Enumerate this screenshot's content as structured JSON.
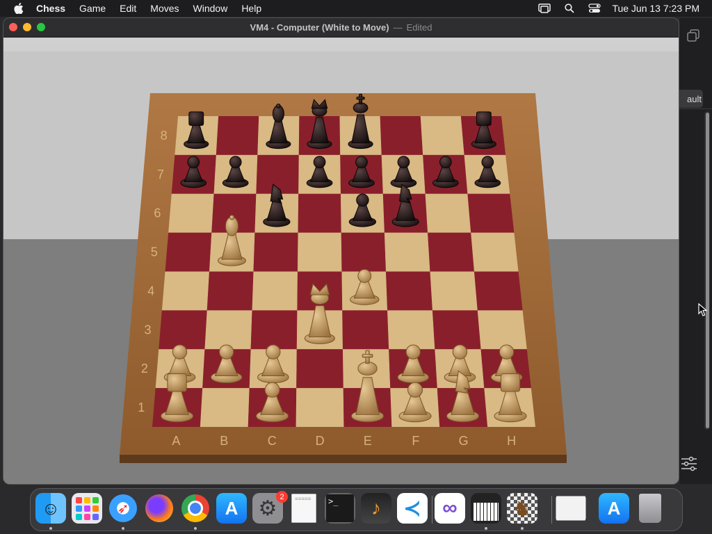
{
  "menubar": {
    "app_name": "Chess",
    "items": [
      "Game",
      "Edit",
      "Moves",
      "Window",
      "Help"
    ],
    "clock": "Tue Jun 13  7:23 PM"
  },
  "window": {
    "title": "VM4 - Computer   (White to Move)",
    "separator": "—",
    "edited": "Edited"
  },
  "background_window": {
    "button_label": "ault"
  },
  "board": {
    "files": [
      "A",
      "B",
      "C",
      "D",
      "E",
      "F",
      "G",
      "H"
    ],
    "ranks": [
      "8",
      "7",
      "6",
      "5",
      "4",
      "3",
      "2",
      "1"
    ],
    "pieces": [
      {
        "color": "black",
        "type": "rook",
        "square": "a8"
      },
      {
        "color": "black",
        "type": "bishop",
        "square": "c8"
      },
      {
        "color": "black",
        "type": "queen",
        "square": "d8"
      },
      {
        "color": "black",
        "type": "king",
        "square": "e8"
      },
      {
        "color": "black",
        "type": "rook",
        "square": "h8"
      },
      {
        "color": "black",
        "type": "pawn",
        "square": "a7"
      },
      {
        "color": "black",
        "type": "pawn",
        "square": "b7"
      },
      {
        "color": "black",
        "type": "pawn",
        "square": "d7"
      },
      {
        "color": "black",
        "type": "pawn",
        "square": "e7"
      },
      {
        "color": "black",
        "type": "pawn",
        "square": "f7"
      },
      {
        "color": "black",
        "type": "pawn",
        "square": "g7"
      },
      {
        "color": "black",
        "type": "pawn",
        "square": "h7"
      },
      {
        "color": "black",
        "type": "knight",
        "square": "c6"
      },
      {
        "color": "black",
        "type": "pawn",
        "square": "e6"
      },
      {
        "color": "black",
        "type": "knight",
        "square": "f6"
      },
      {
        "color": "white",
        "type": "bishop",
        "square": "b5"
      },
      {
        "color": "white",
        "type": "pawn",
        "square": "e4"
      },
      {
        "color": "white",
        "type": "queen",
        "square": "d3"
      },
      {
        "color": "white",
        "type": "pawn",
        "square": "a2"
      },
      {
        "color": "white",
        "type": "pawn",
        "square": "b2"
      },
      {
        "color": "white",
        "type": "pawn",
        "square": "c2"
      },
      {
        "color": "white",
        "type": "pawn",
        "square": "f2"
      },
      {
        "color": "white",
        "type": "pawn",
        "square": "g2"
      },
      {
        "color": "white",
        "type": "pawn",
        "square": "h2"
      },
      {
        "color": "white",
        "type": "rook",
        "square": "a1"
      },
      {
        "color": "white",
        "type": "pawn",
        "square": "c1"
      },
      {
        "color": "white",
        "type": "king",
        "square": "e1"
      },
      {
        "color": "white",
        "type": "pawn",
        "square": "f1"
      },
      {
        "color": "white",
        "type": "knight",
        "square": "g1"
      },
      {
        "color": "white",
        "type": "rook",
        "square": "h1"
      }
    ]
  },
  "dock": {
    "apps": [
      {
        "name": "Finder",
        "icon": "finder-icon",
        "running": true
      },
      {
        "name": "Launchpad",
        "icon": "launchpad-icon",
        "running": false
      },
      {
        "name": "Safari",
        "icon": "safari-icon",
        "running": true
      },
      {
        "name": "Firefox",
        "icon": "firefox-icon",
        "running": false
      },
      {
        "name": "Chrome",
        "icon": "chrome-icon",
        "running": true
      },
      {
        "name": "App Store",
        "icon": "app-store-icon",
        "running": false
      },
      {
        "name": "System Settings",
        "icon": "system-settings-icon",
        "running": false,
        "badge": "2"
      },
      {
        "name": "TextEdit",
        "icon": "textedit-icon",
        "running": false
      },
      {
        "name": "Terminal",
        "icon": "terminal-icon",
        "running": false
      },
      {
        "name": "GarageBand",
        "icon": "garageband-icon",
        "running": false
      },
      {
        "name": "VS Code",
        "icon": "vscode-icon",
        "running": false
      },
      {
        "name": "Visual Studio",
        "icon": "visual-studio-icon",
        "running": false
      },
      {
        "name": "Piano",
        "icon": "piano-icon",
        "running": true
      },
      {
        "name": "Chess",
        "icon": "chess-icon",
        "running": true
      },
      {
        "name": "Preview",
        "icon": "preview-icon",
        "running": false
      },
      {
        "name": "App Store 2",
        "icon": "app-store-icon",
        "running": false
      },
      {
        "name": "Trash",
        "icon": "trash-icon",
        "running": false
      }
    ]
  },
  "colors": {
    "light_square": "#d9b984",
    "dark_square": "#8a1f2c",
    "frame": "#a0693a",
    "white_piece": "#c9a063",
    "black_piece": "#2a1e1e"
  }
}
